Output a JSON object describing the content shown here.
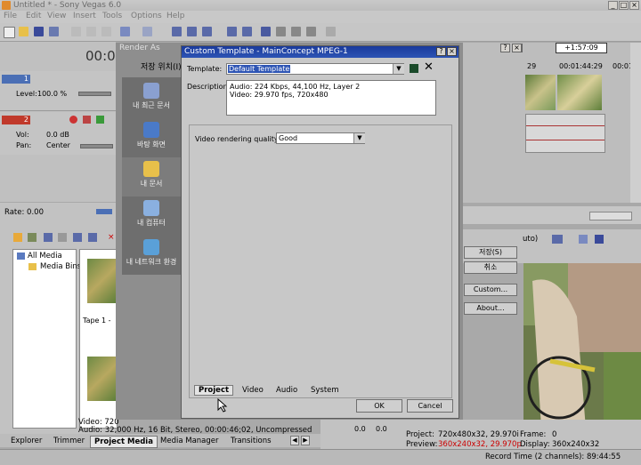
{
  "window": {
    "title": "Untitled * - Sony Vegas 6.0",
    "controls": [
      "_",
      "□",
      "×"
    ]
  },
  "menu": [
    "File",
    "Edit",
    "View",
    "Insert",
    "Tools",
    "Options",
    "Help"
  ],
  "timecode": "00:0",
  "marker_time": "+1:57:09",
  "ruler_times": [
    "29",
    "00:01:44:29",
    "00:01"
  ],
  "tracks": [
    {
      "number": "1",
      "level_label": "Level:",
      "level_value": "100.0 %"
    },
    {
      "number": "2",
      "vol_label": "Vol:",
      "vol_value": "0.0 dB",
      "pan_label": "Pan:",
      "pan_value": "Center"
    }
  ],
  "rate": "Rate: 0.00",
  "media_tree": [
    {
      "label": "All Media"
    },
    {
      "label": "Media Bins"
    }
  ],
  "media_item_label": "Tape 1 -",
  "media_info": {
    "line1": "Video: 720",
    "line2": "Audio: 32,000 Hz, 16 Bit, Stereo, 00:00:46;02, Uncompressed"
  },
  "bottom_tabs": [
    "Explorer",
    "Trimmer",
    "Project Media",
    "Media Manager",
    "Transitions"
  ],
  "mixer_values": [
    "0.0",
    "0.0"
  ],
  "render_as": {
    "title": "Render As",
    "save_in_label": "저장 위치(I):",
    "places": [
      "내 최근 문서",
      "바탕 화면",
      "내 문서",
      "내 컴퓨터",
      "내 네트워크 환경"
    ],
    "buttons": [
      "저장(S)",
      "취소",
      "Custom...",
      "About..."
    ]
  },
  "custom_template": {
    "title": "Custom Template - MainConcept MPEG-1",
    "template_label": "Template:",
    "template_value": "Default Template",
    "description_label": "Description:",
    "description_lines": [
      "Audio: 224 Kbps, 44,100 Hz, Layer 2",
      "Video: 29.970 fps, 720x480"
    ],
    "quality_label": "Video rendering quality:",
    "quality_value": "Good",
    "tabs": [
      "Project",
      "Video",
      "Audio",
      "System"
    ],
    "ok": "OK",
    "cancel": "Cancel"
  },
  "preview_prefix": "uto)",
  "status": {
    "project_label": "Project:",
    "project_value": "720x480x32, 29.970i",
    "preview_label": "Preview:",
    "preview_value": "360x240x32, 29.970p",
    "frame_label": "Frame:",
    "frame_value": "0",
    "display_label": "Display:",
    "display_value": "360x240x32",
    "record_time": "Record Time (2 channels): 89:44:55"
  },
  "colors": {
    "accent": "#2d54b4",
    "warning_text": "#cc0000",
    "track1": "#4b6fb5",
    "track2": "#c0392b"
  }
}
